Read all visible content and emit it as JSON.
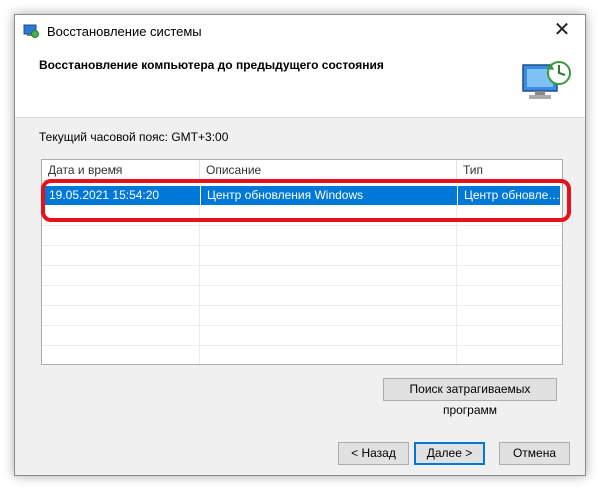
{
  "window": {
    "title": "Восстановление системы",
    "close_symbol": "✕"
  },
  "header": {
    "title": "Восстановление компьютера до предыдущего состояния",
    "icon": "system-restore-icon"
  },
  "timezone_label": "Текущий часовой пояс: GMT+3:00",
  "table": {
    "columns": [
      "Дата и время",
      "Описание",
      "Тип"
    ],
    "sort_indicator": "˅",
    "rows": [
      {
        "date": "19.05.2021 15:54:20",
        "description": "Центр обновления Windows",
        "type": "Центр обновле…",
        "selected": true
      }
    ]
  },
  "buttons": {
    "search": "Поиск затрагиваемых программ",
    "back": "< Назад",
    "next": "Далее >",
    "cancel": "Отмена"
  },
  "colors": {
    "selection": "#0078d7",
    "highlight": "#e8101a"
  }
}
